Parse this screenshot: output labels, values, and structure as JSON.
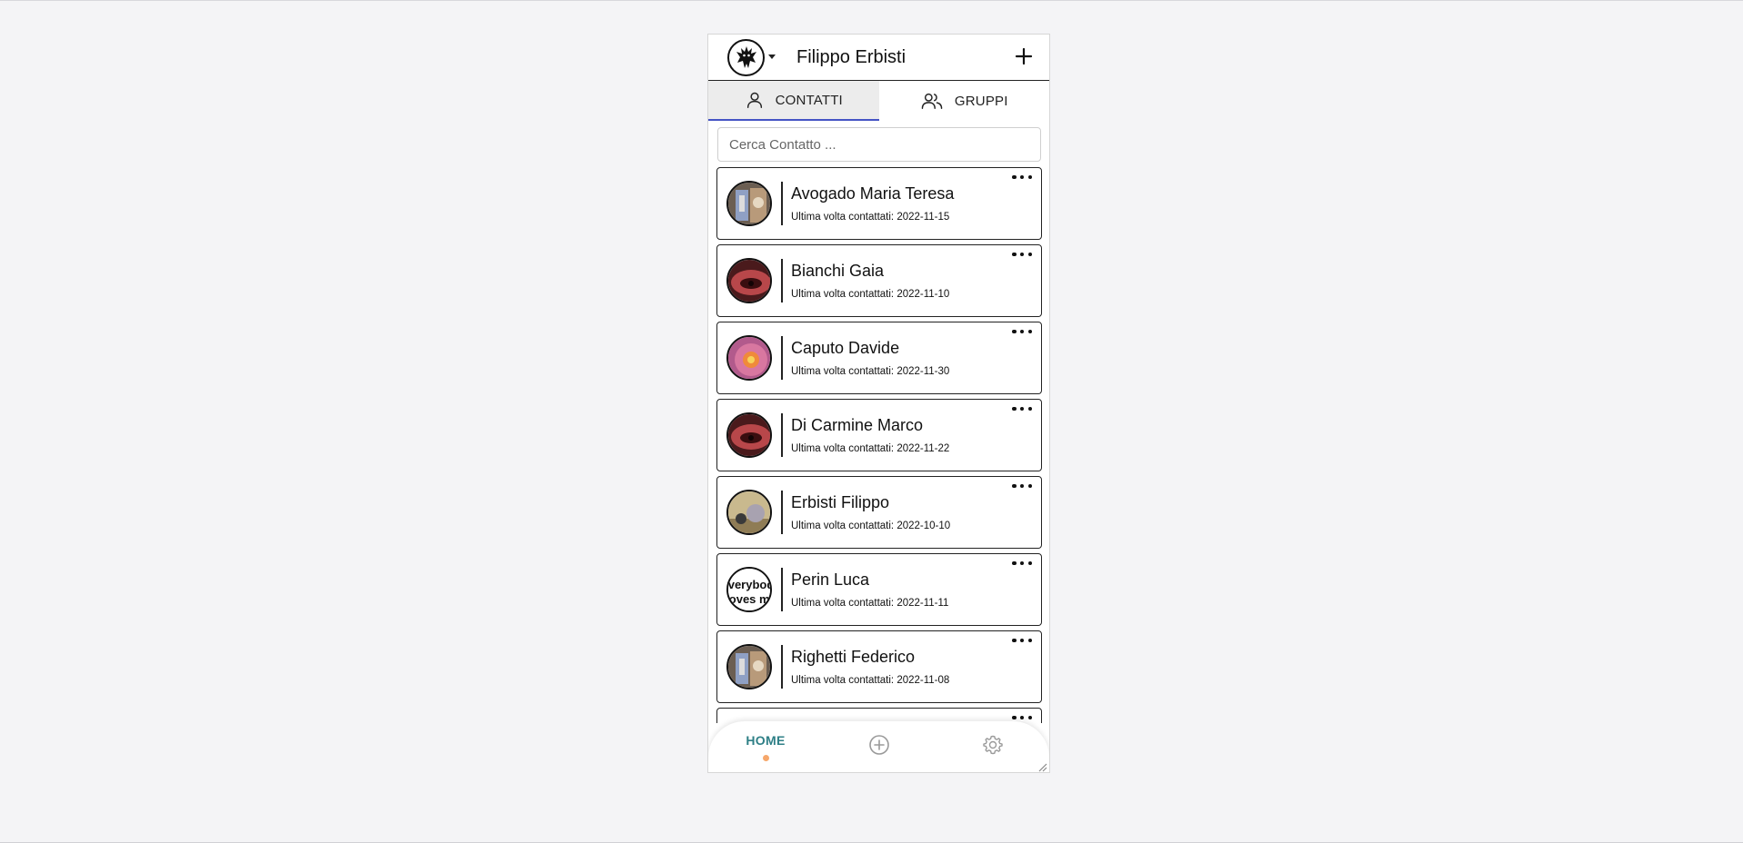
{
  "header": {
    "title": "Filippo Erbisti",
    "avatar_icon": "bat-logo-icon",
    "add_icon": "plus-icon"
  },
  "tabs": [
    {
      "label": "CONTATTI",
      "icon": "person-icon",
      "active": true
    },
    {
      "label": "GRUPPI",
      "icon": "people-icon",
      "active": false
    }
  ],
  "search": {
    "placeholder": "Cerca Contatto ...",
    "value": ""
  },
  "contacts": [
    {
      "name": "Avogado Maria Teresa",
      "last_contact": "Ultima volta contattati: 2022-11-15"
    },
    {
      "name": "Bianchi Gaia",
      "last_contact": "Ultima volta contattati: 2022-11-10"
    },
    {
      "name": "Caputo Davide",
      "last_contact": "Ultima volta contattati: 2022-11-30"
    },
    {
      "name": "Di Carmine Marco",
      "last_contact": "Ultima volta contattati: 2022-11-22"
    },
    {
      "name": "Erbisti Filippo",
      "last_contact": "Ultima volta contattati: 2022-10-10"
    },
    {
      "name": "Perin Luca",
      "last_contact": "Ultima volta contattati: 2022-11-11",
      "avatar_text": "everybody loves me"
    },
    {
      "name": "Righetti Federico",
      "last_contact": "Ultima volta contattati: 2022-11-08"
    }
  ],
  "bottom_nav": {
    "home_label": "HOME",
    "add_icon": "circle-plus-icon",
    "settings_icon": "gear-icon"
  },
  "colors": {
    "tab_active_underline": "#4453c4",
    "nav_home": "#2e7f86",
    "nav_dot": "#f6a76b"
  }
}
